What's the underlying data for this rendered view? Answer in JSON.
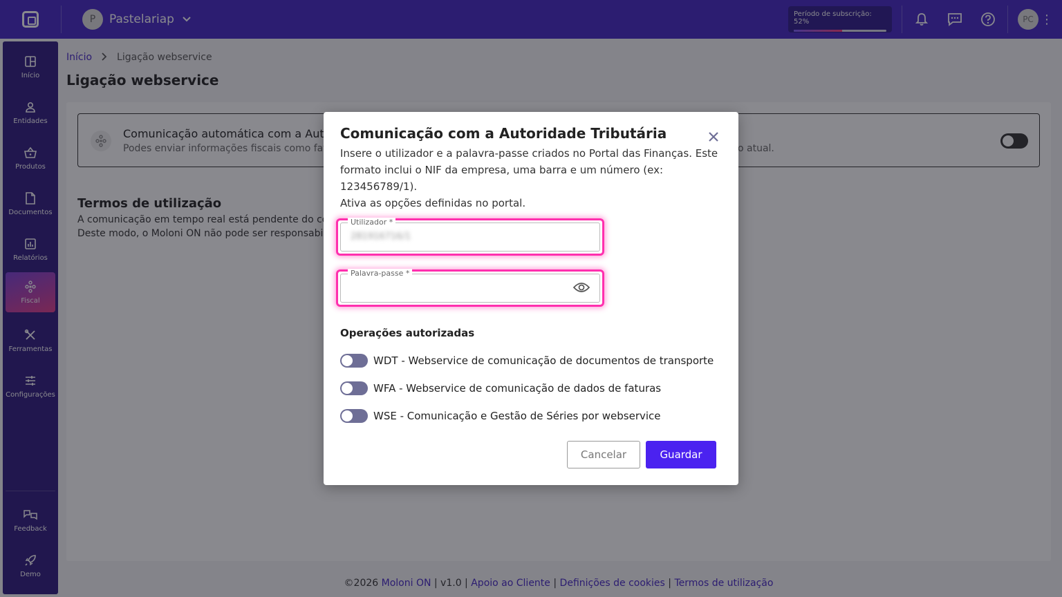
{
  "topbar": {
    "company_initial": "P",
    "company_name": "Pastelariap",
    "subscription_label": "Período de subscrição: 52%",
    "subscription_progress": 0.52,
    "user_initials": "PC"
  },
  "sidebar": {
    "items": [
      {
        "label": "Início",
        "icon": "dashboard-icon"
      },
      {
        "label": "Entidades",
        "icon": "user-icon"
      },
      {
        "label": "Produtos",
        "icon": "basket-icon"
      },
      {
        "label": "Documentos",
        "icon": "document-icon"
      },
      {
        "label": "Relatórios",
        "icon": "chart-icon"
      },
      {
        "label": "Fiscal",
        "icon": "fiscal-icon"
      },
      {
        "label": "Ferramentas",
        "icon": "tools-icon"
      },
      {
        "label": "Configurações",
        "icon": "sliders-icon"
      }
    ],
    "bottom_items": [
      {
        "label": "Feedback",
        "icon": "feedback-icon"
      },
      {
        "label": "Demo",
        "icon": "rocket-icon"
      }
    ]
  },
  "breadcrumb": {
    "home": "Início",
    "current": "Ligação webservice"
  },
  "page": {
    "title": "Ligação webservice",
    "card_title": "Comunicação automática com a Autori",
    "card_subtitle": "Podes enviar informações fiscais como fatur",
    "card_subtitle_tail": "o atual.",
    "terms_title": "Termos de utilização",
    "terms_line1": "A comunicação em tempo real está pendente do corre",
    "terms_line2": "Deste modo, o Moloni ON não pode ser responsabiliza"
  },
  "footer": {
    "copyright": "©2026",
    "brand": "Moloni ON",
    "version": "| v1.0 |",
    "support": "Apoio ao Cliente",
    "cookies": "Definições de cookies",
    "terms": "Termos de utilização",
    "sep": "|"
  },
  "modal": {
    "title": "Comunicação com a Autoridade Tributária",
    "description": "Insere o utilizador e a palavra-passe criados no Portal das Finanças. Este formato inclui o NIF da empresa, uma barra e um número (ex: 123456789/1).",
    "description2": "Ativa as opções definidas no portal.",
    "user_label": "Utilizador *",
    "user_value": "281916716/1",
    "password_label": "Palavra-passe *",
    "ops_title": "Operações autorizadas",
    "operations": [
      "WDT - Webservice de comunicação de documentos de transporte",
      "WFA - Webservice de comunicação de dados de faturas",
      "WSE - Comunicação e Gestão de Séries por webservice"
    ],
    "cancel_label": "Cancelar",
    "save_label": "Guardar"
  }
}
